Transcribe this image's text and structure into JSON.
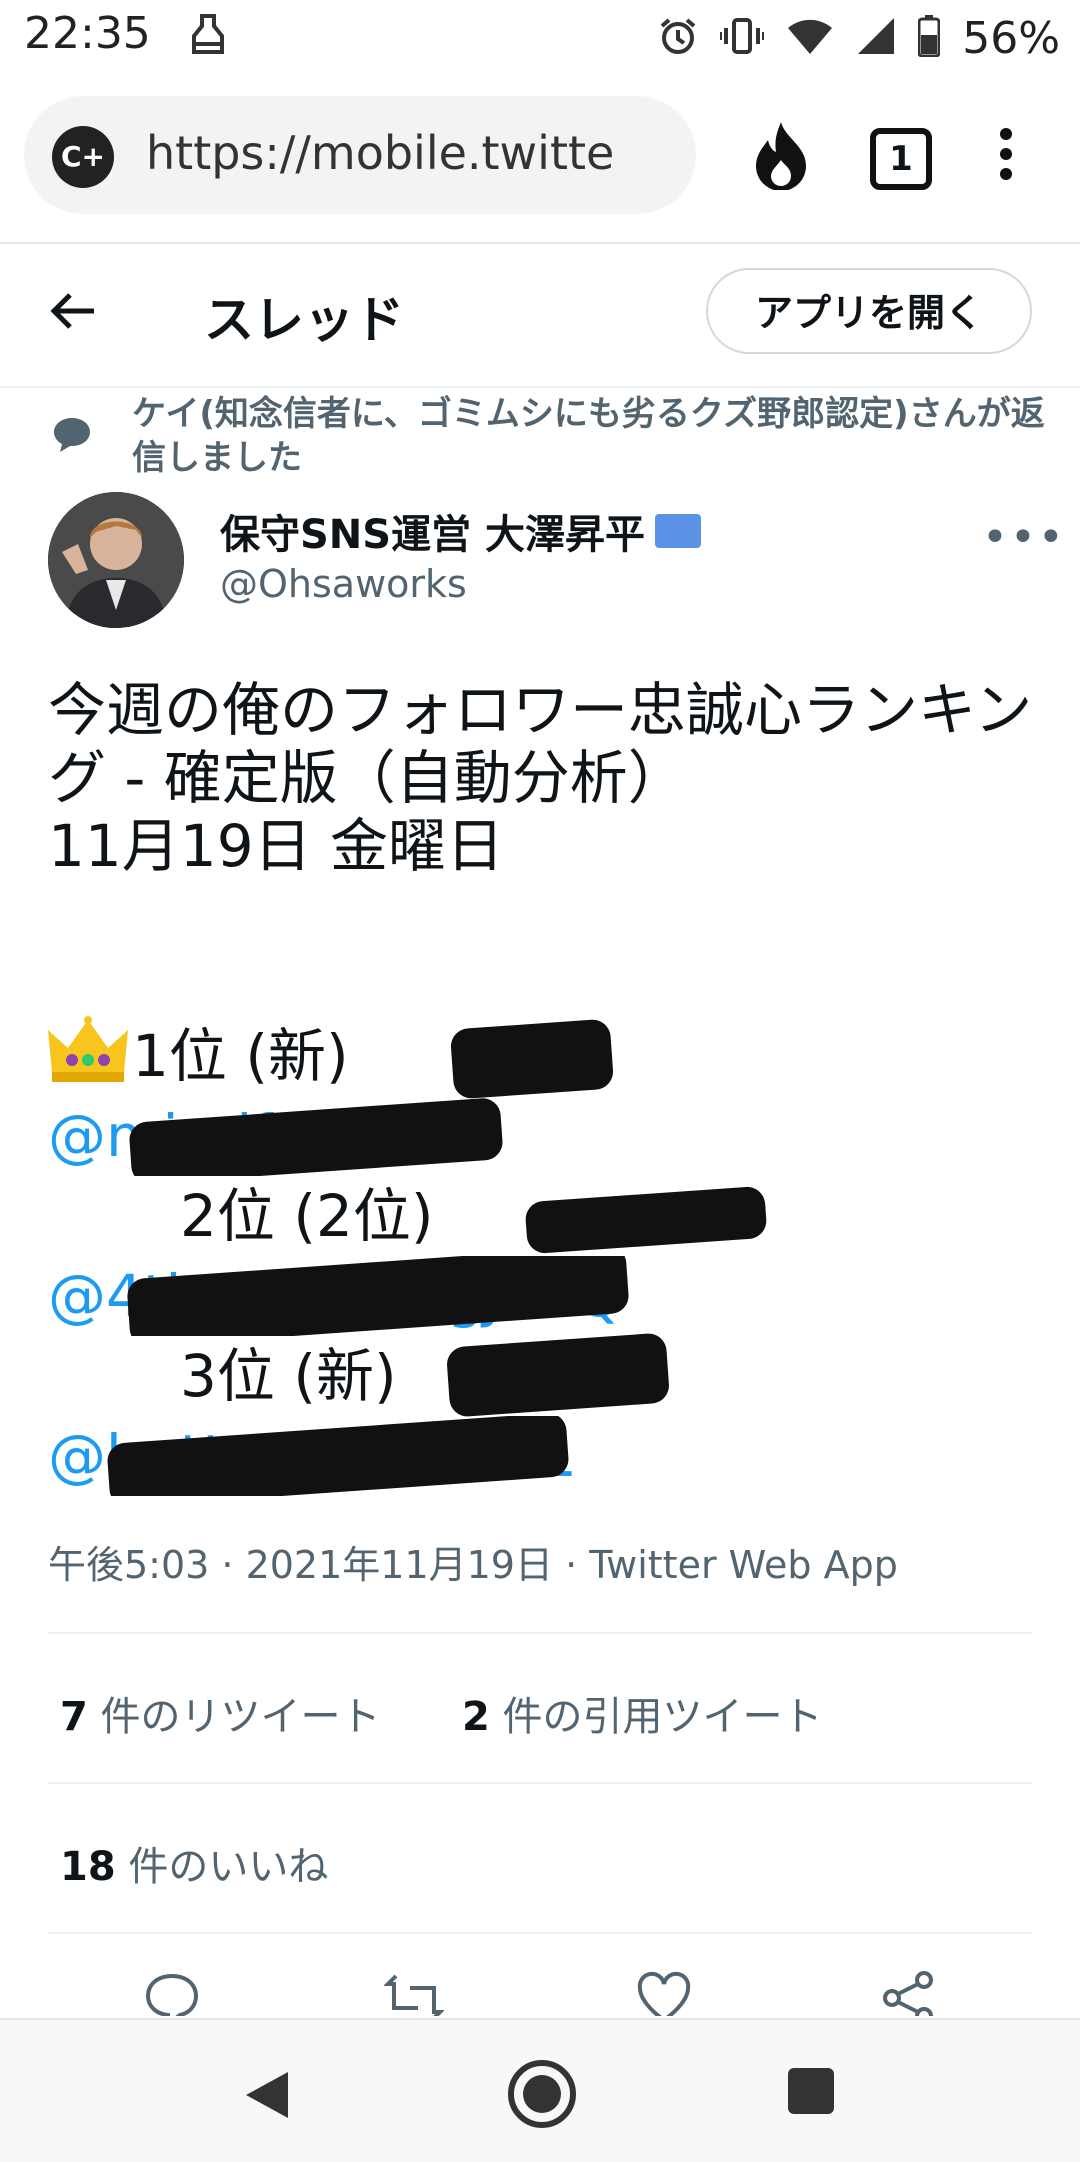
{
  "status_bar": {
    "time": "22:35",
    "battery": "56%"
  },
  "browser": {
    "url": "https://mobile.twitte",
    "tab_count": "1",
    "badge": "C+"
  },
  "header": {
    "title": "スレッド",
    "open_app": "アプリを開く"
  },
  "reply_context": "ケイ(知念信者に、ゴミムシにも劣るクズ野郎認定)さんが返信しました",
  "author": {
    "name": "保守SNS運営 大澤昇平",
    "handle": "@Ohsaworks"
  },
  "tweet": {
    "line1": "今週の俺のフォロワー忠誠心ランキング - 確定版（自動分析）",
    "line2": "11月19日 金曜日",
    "rank1": "1位 (新)",
    "rank1_handle": "@mindfantasia",
    "rank2": "2位 (2位)",
    "rank2_handle": "@4thanKENI2gJBTQ",
    "rank3": "3位 (新)",
    "rank3_handle": "@butterfly011231"
  },
  "meta": "午後5:03 · 2021年11月19日 · Twitter Web App",
  "stats": {
    "retweets_count": "7",
    "retweets_label": " 件のリツイート",
    "quotes_count": "2",
    "quotes_label": " 件の引用ツイート",
    "likes_count": "18",
    "likes_label": " 件のいいね"
  }
}
